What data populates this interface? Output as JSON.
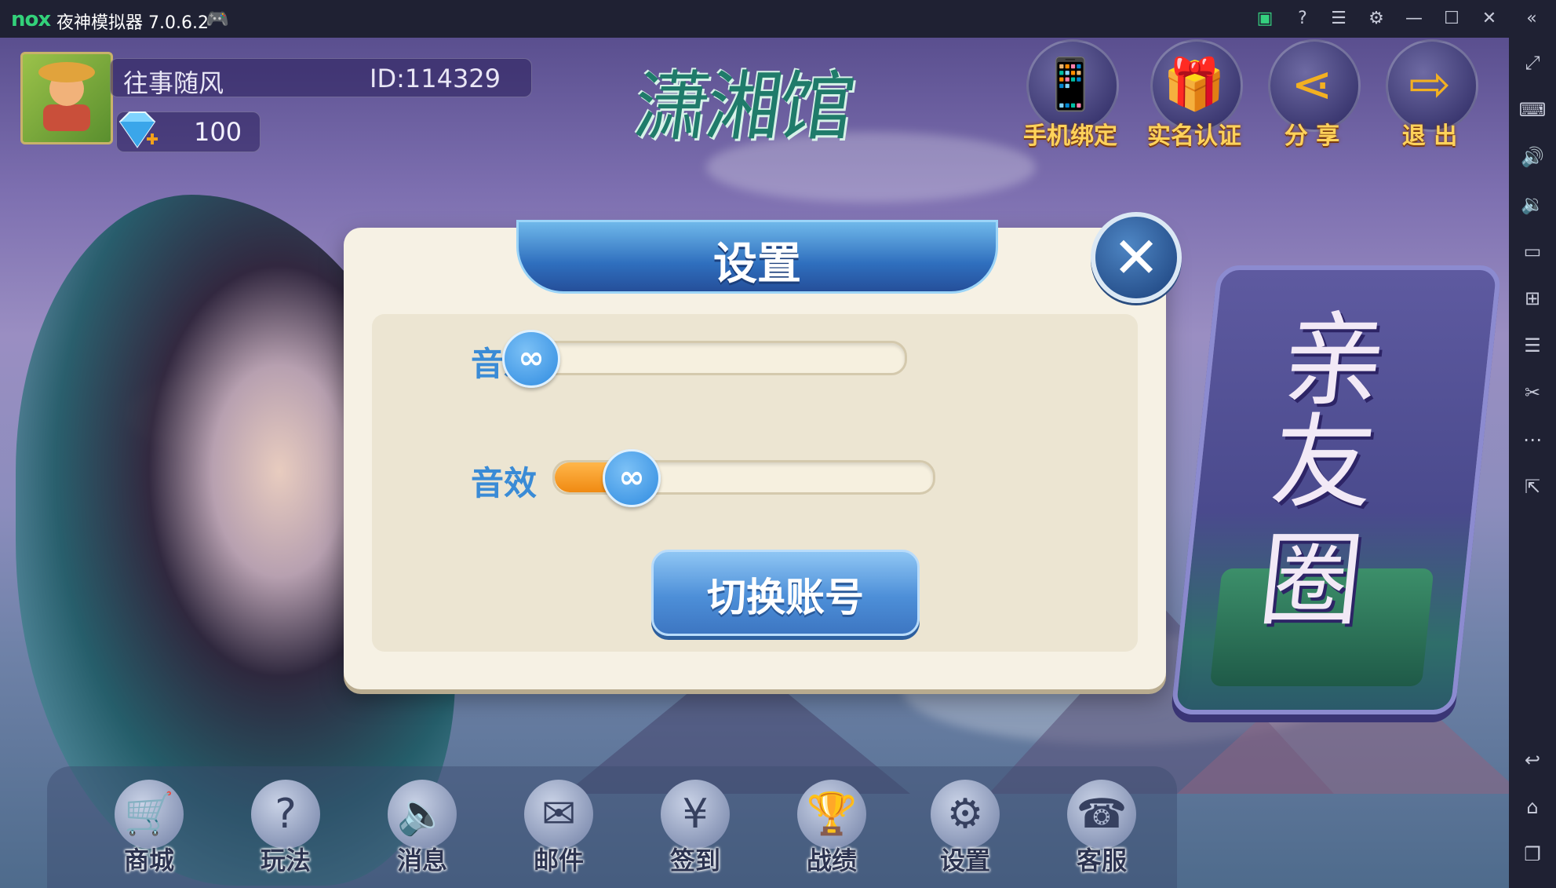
{
  "emulator": {
    "logo": "nox",
    "title": "夜神模拟器 7.0.6.2",
    "title_icons": [
      "gamepad-icon"
    ],
    "window_controls": [
      "store-icon",
      "help-icon",
      "menu-icon",
      "settings-icon",
      "minimize-icon",
      "maximize-icon",
      "close-icon",
      "collapse-icon"
    ],
    "sidebar_tools": [
      "fullscreen-icon",
      "keyboard-icon",
      "volume-up-icon",
      "volume-down-icon",
      "screen-icon",
      "apk-install-icon",
      "multi-instance-icon",
      "screenshot-icon",
      "more-icon",
      "share-icon",
      "back-icon",
      "home-icon",
      "recent-apps-icon"
    ]
  },
  "user": {
    "name": "往事随风",
    "id": "ID:114329",
    "diamonds": "100"
  },
  "game_logo": "潇湘馆",
  "top_buttons": [
    {
      "label": "手机绑定",
      "icon": "phone-bind-icon"
    },
    {
      "label": "实名认证",
      "icon": "gift-icon"
    },
    {
      "label": "分 享",
      "icon": "share-icon"
    },
    {
      "label": "退 出",
      "icon": "exit-icon"
    }
  ],
  "friends_circle": {
    "chars": [
      "亲",
      "友",
      "圈"
    ]
  },
  "settings_dialog": {
    "title": "设置",
    "music_label": "音乐",
    "music_level": 0.0,
    "sfx_label": "音效",
    "sfx_level": 0.2,
    "knob_symbol": "∞",
    "switch_account": "切换账号"
  },
  "bottom_menu": [
    {
      "label": "商城",
      "icon": "cart-icon"
    },
    {
      "label": "玩法",
      "icon": "question-icon"
    },
    {
      "label": "消息",
      "icon": "speaker-icon"
    },
    {
      "label": "邮件",
      "icon": "mail-icon"
    },
    {
      "label": "签到",
      "icon": "yen-icon"
    },
    {
      "label": "战绩",
      "icon": "trophy-icon"
    },
    {
      "label": "设置",
      "icon": "gear-icon"
    },
    {
      "label": "客服",
      "icon": "headset-icon"
    }
  ],
  "colors": {
    "accent_blue": "#3a8bd6",
    "accent_orange": "#f08a12",
    "gold_label": "#ffd25a"
  }
}
